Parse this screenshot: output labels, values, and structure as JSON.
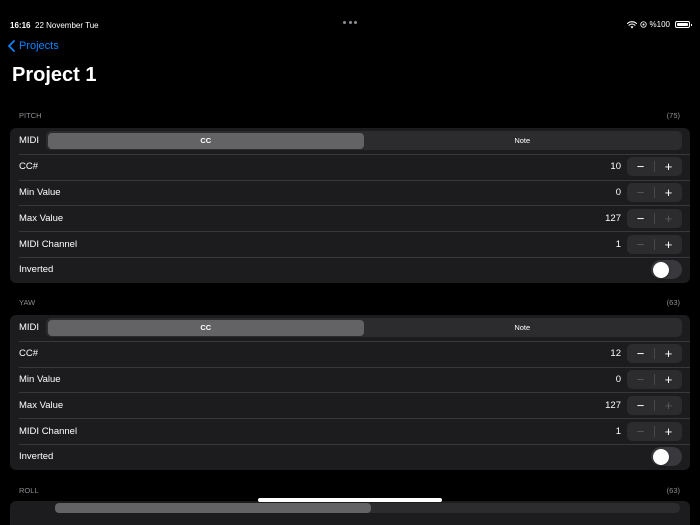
{
  "status": {
    "time": "16:16",
    "date": "22 November Tue",
    "battery": "%100",
    "battery_level": 1.0
  },
  "nav": {
    "back_label": "Projects",
    "title": "Project 1"
  },
  "sections": [
    {
      "header": "PITCH",
      "count": "(75)",
      "midi_label": "MIDI",
      "seg_cc": "CC",
      "seg_note": "Note",
      "selected": "CC",
      "rows": [
        {
          "label": "CC#",
          "value": "10",
          "minus_enabled": true,
          "plus_enabled": true
        },
        {
          "label": "Min Value",
          "value": "0",
          "minus_enabled": false,
          "plus_enabled": true
        },
        {
          "label": "Max Value",
          "value": "127",
          "minus_enabled": true,
          "plus_enabled": false
        },
        {
          "label": "MIDI Channel",
          "value": "1",
          "minus_enabled": false,
          "plus_enabled": true
        }
      ],
      "inverted_label": "Inverted",
      "inverted": false
    },
    {
      "header": "YAW",
      "count": "(63)",
      "midi_label": "MIDI",
      "seg_cc": "CC",
      "seg_note": "Note",
      "selected": "CC",
      "rows": [
        {
          "label": "CC#",
          "value": "12",
          "minus_enabled": true,
          "plus_enabled": true
        },
        {
          "label": "Min Value",
          "value": "0",
          "minus_enabled": false,
          "plus_enabled": true
        },
        {
          "label": "Max Value",
          "value": "127",
          "minus_enabled": true,
          "plus_enabled": false
        },
        {
          "label": "MIDI Channel",
          "value": "1",
          "minus_enabled": false,
          "plus_enabled": true
        }
      ],
      "inverted_label": "Inverted",
      "inverted": false
    },
    {
      "header": "ROLL",
      "count": "(63)"
    }
  ],
  "stepper": {
    "minus": "−",
    "plus": "+"
  }
}
